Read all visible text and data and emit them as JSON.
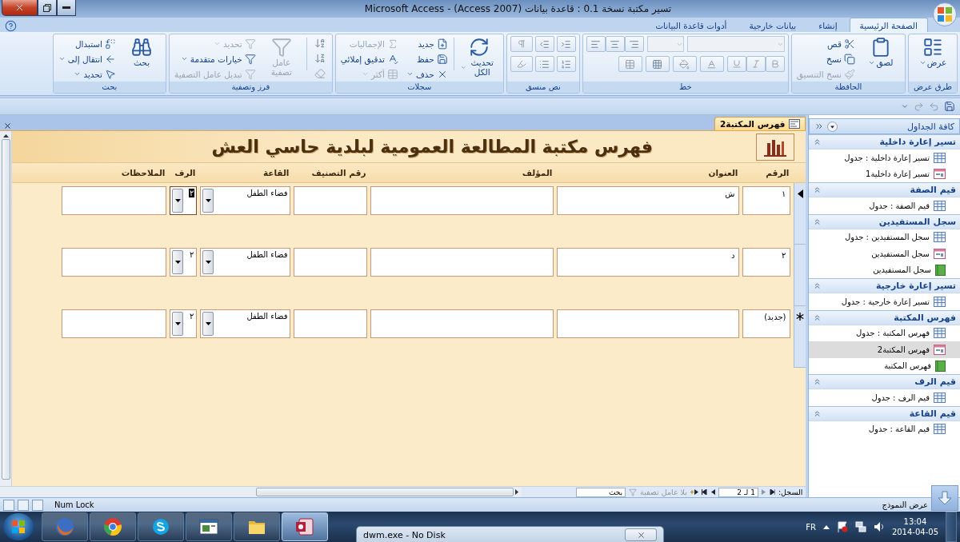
{
  "window": {
    "title": "تسير مكتبة نسخة 0.1 : قاعدة بيانات (Access 2007) - Microsoft Access"
  },
  "ribbon_tabs": [
    {
      "label": "الصفحة الرئيسية",
      "selected": true
    },
    {
      "label": "إنشاء",
      "selected": false
    },
    {
      "label": "بيانات خارجية",
      "selected": false
    },
    {
      "label": "أدوات قاعدة البيانات",
      "selected": false
    }
  ],
  "ribbon_groups": [
    {
      "label": "طرق عرض",
      "kind": "commands",
      "large": [
        {
          "label": "عرض",
          "disabled": false,
          "has_menu": true
        }
      ]
    },
    {
      "label": "الحافظة",
      "kind": "commands",
      "large": [
        {
          "label": "لصق",
          "disabled": false,
          "has_menu": true
        }
      ],
      "small": [
        {
          "label": "قص",
          "disabled": false,
          "has_menu": false
        },
        {
          "label": "نسخ",
          "disabled": false,
          "has_menu": false
        },
        {
          "label": "نسخ التنسيق",
          "disabled": true,
          "has_menu": false
        }
      ]
    },
    {
      "label": "خط",
      "kind": "font"
    },
    {
      "label": "نص منسق",
      "kind": "rich_text"
    },
    {
      "label": "سجلات",
      "kind": "commands",
      "large": [
        {
          "label": "تحديث الكل",
          "disabled": false,
          "has_menu": true
        }
      ],
      "small": [
        {
          "label": "جديد",
          "disabled": false,
          "has_menu": false
        },
        {
          "label": "حفظ",
          "disabled": false,
          "has_menu": false
        },
        {
          "label": "حذف",
          "disabled": false,
          "has_menu": true
        },
        {
          "label": "الإجماليات",
          "disabled": true,
          "has_menu": false
        },
        {
          "label": "تدقيق إملائي",
          "disabled": false,
          "has_menu": false
        },
        {
          "label": "أكثر",
          "disabled": true,
          "has_menu": true
        }
      ]
    },
    {
      "label": "فرز وتصفية",
      "kind": "sort_filter",
      "large": [
        {
          "label": "عامل تصفية",
          "disabled": true,
          "has_menu": false
        }
      ],
      "small": [
        {
          "label": "تحديد",
          "disabled": true,
          "has_menu": true
        },
        {
          "label": "خيارات متقدمة",
          "disabled": false,
          "has_menu": true
        },
        {
          "label": "تبديل عامل التصفية",
          "disabled": true,
          "has_menu": false
        }
      ]
    },
    {
      "label": "بحث",
      "kind": "commands",
      "large": [
        {
          "label": "بحث",
          "disabled": false,
          "has_menu": false
        }
      ],
      "small": [
        {
          "label": "استبدال",
          "disabled": false,
          "has_menu": false
        },
        {
          "label": "انتقال إلى",
          "disabled": false,
          "has_menu": true
        },
        {
          "label": "تحديد",
          "disabled": false,
          "has_menu": true
        }
      ]
    }
  ],
  "form": {
    "tab": "فهرس المكتبة2",
    "heading": "فهرس مكتبة المطالعة العمومية لبلدية حاسي العش",
    "columns": [
      "الرقم",
      "العنوان",
      "المؤلف",
      "رقم التصنيف",
      "القاعة",
      "الرف",
      "الملاحظات"
    ],
    "rows": [
      {
        "current": true,
        "new": false,
        "cells": [
          {
            "kind": "text",
            "value": "١",
            "focused": false
          },
          {
            "kind": "text",
            "value": "ش",
            "focused": false
          },
          {
            "kind": "text",
            "focused": false
          },
          {
            "kind": "text",
            "focused": false
          },
          {
            "kind": "combo",
            "value": "فضاء الطفل",
            "focused": false
          },
          {
            "kind": "combo",
            "value": "٢",
            "focused": true
          },
          {
            "kind": "text",
            "focused": false
          }
        ]
      },
      {
        "current": false,
        "new": false,
        "cells": [
          {
            "kind": "text",
            "value": "٢",
            "focused": false
          },
          {
            "kind": "text",
            "value": "د",
            "focused": false
          },
          {
            "kind": "text",
            "focused": false
          },
          {
            "kind": "text",
            "focused": false
          },
          {
            "kind": "combo",
            "value": "فضاء الطفل",
            "focused": false
          },
          {
            "kind": "combo",
            "value": "٢",
            "focused": false
          },
          {
            "kind": "text",
            "focused": false
          }
        ]
      },
      {
        "current": false,
        "new": true,
        "cells": [
          {
            "kind": "text",
            "value": "(جديد)",
            "focused": false
          },
          {
            "kind": "text",
            "focused": false
          },
          {
            "kind": "text",
            "focused": false
          },
          {
            "kind": "text",
            "focused": false
          },
          {
            "kind": "combo",
            "value": "فضاء الطفل",
            "focused": false
          },
          {
            "kind": "combo",
            "value": "٢",
            "focused": false
          },
          {
            "kind": "text",
            "focused": false
          }
        ]
      }
    ]
  },
  "record_nav": {
    "label": "السجل:",
    "position": "1 لـ 2",
    "filter": "بلا عامل تصفية",
    "search_placeholder": "بحث"
  },
  "nav_pane": {
    "title": "كافة الجداول",
    "groups": [
      {
        "label": "تسير إعارة داخلية",
        "items": [
          {
            "label": "تسير إعارة داخلية : جدول",
            "kind": "table",
            "selected": false
          },
          {
            "label": "تسير إعارة داخلية1",
            "kind": "form",
            "selected": false
          }
        ]
      },
      {
        "label": "قيم الصفة",
        "items": [
          {
            "label": "قيم الصفة : جدول",
            "kind": "table",
            "selected": false
          }
        ]
      },
      {
        "label": "سجل المستفيدين",
        "items": [
          {
            "label": "سجل المستفيدين : جدول",
            "kind": "table",
            "selected": false
          },
          {
            "label": "سجل المستفيدين",
            "kind": "form",
            "selected": false
          },
          {
            "label": "سجل المستفيدين",
            "kind": "report",
            "selected": false
          }
        ]
      },
      {
        "label": "تسير إعارة خارجية",
        "items": [
          {
            "label": "تسير إعارة خارجية : جدول",
            "kind": "table",
            "selected": false
          }
        ]
      },
      {
        "label": "فهرس المكتبة",
        "items": [
          {
            "label": "فهرس المكتبة : جدول",
            "kind": "table",
            "selected": false
          },
          {
            "label": "فهرس المكتبة2",
            "kind": "form",
            "selected": true
          },
          {
            "label": "فهرس المكتبة",
            "kind": "report",
            "selected": false
          }
        ]
      },
      {
        "label": "قيم الرف",
        "items": [
          {
            "label": "قيم الرف : جدول",
            "kind": "table",
            "selected": false
          }
        ]
      },
      {
        "label": "قيم القاعة",
        "items": [
          {
            "label": "قيم القاعة : جدول",
            "kind": "table",
            "selected": false
          }
        ]
      }
    ]
  },
  "status_bar": {
    "view": "عرض النموذج",
    "indicator": "Num Lock"
  },
  "taskbar": {
    "apps": [
      {
        "kind": "firefox",
        "active": false
      },
      {
        "kind": "chrome",
        "active": false
      },
      {
        "kind": "skype",
        "active": false
      },
      {
        "kind": "app",
        "active": false
      },
      {
        "kind": "explorer",
        "active": false
      },
      {
        "kind": "access",
        "active": true
      }
    ],
    "popup": "dwm.exe - No Disk",
    "language": "FR",
    "time": "13:04",
    "date": "2014-04-05"
  }
}
